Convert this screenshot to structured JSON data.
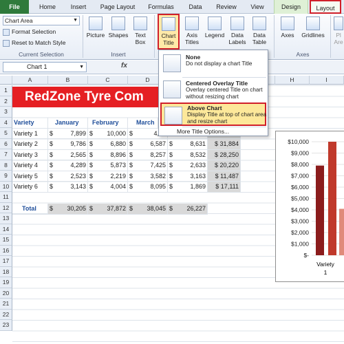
{
  "tabs": [
    {
      "label": "File"
    },
    {
      "label": "Home"
    },
    {
      "label": "Insert"
    },
    {
      "label": "Page Layout"
    },
    {
      "label": "Formulas"
    },
    {
      "label": "Data"
    },
    {
      "label": "Review"
    },
    {
      "label": "View"
    },
    {
      "label": "Design"
    },
    {
      "label": "Layout"
    }
  ],
  "ribbon": {
    "chart_element_dropdown": "Chart Area",
    "format_selection": "Format Selection",
    "reset_to_match_style": "Reset to Match Style",
    "current_selection_group": "Current Selection",
    "picture": "Picture",
    "shapes": "Shapes",
    "text_box_1": "Text",
    "text_box_2": "Box",
    "insert_group": "Insert",
    "chart_title_1": "Chart",
    "chart_title_2": "Title",
    "axis_titles_1": "Axis",
    "axis_titles_2": "Titles",
    "legend": "Legend",
    "data_labels_1": "Data",
    "data_labels_2": "Labels",
    "data_table_1": "Data",
    "data_table_2": "Table",
    "axes": "Axes",
    "gridlines": "Gridlines",
    "plot_area_1": "Pl",
    "plot_area_2": "Are",
    "axes_group": "Axes"
  },
  "formula_bar": {
    "name_box": "Chart 1",
    "fx": "fx"
  },
  "menu": {
    "items": [
      {
        "title": "None",
        "desc": "Do not display a chart Title"
      },
      {
        "title": "Centered Overlay Title",
        "desc": "Overlay centered Title on chart without resizing chart"
      },
      {
        "title": "Above Chart",
        "desc": "Display Title at top of chart area and resize chart"
      }
    ],
    "more": "More Title Options..."
  },
  "columns": [
    "A",
    "B",
    "C",
    "D",
    "E",
    "F",
    "G",
    "H",
    "I"
  ],
  "rows": [
    "1",
    "2",
    "3",
    "4",
    "5",
    "6",
    "7",
    "8",
    "9",
    "10",
    "11",
    "12",
    "13",
    "14",
    "15",
    "16",
    "17",
    "18",
    "19",
    "20",
    "21",
    "22",
    "23"
  ],
  "sheet": {
    "title": "RedZone Tyre Com",
    "headers": [
      "Variety",
      "January",
      "February",
      "March"
    ],
    "varieties": [
      {
        "name": "Variety 1",
        "jan": "7,899",
        "feb": "10,000",
        "mar": "4,09",
        "e": "",
        "total": ""
      },
      {
        "name": "Variety 2",
        "jan": "9,786",
        "feb": "6,880",
        "mar": "6,587",
        "e": "8,631",
        "total": "$ 31,884"
      },
      {
        "name": "Variety 3",
        "jan": "2,565",
        "feb": "8,896",
        "mar": "8,257",
        "e": "8,532",
        "total": "$ 28,250"
      },
      {
        "name": "Variety 4",
        "jan": "4,289",
        "feb": "5,873",
        "mar": "7,425",
        "e": "2,633",
        "total": "$ 20,220"
      },
      {
        "name": "Variety 5",
        "jan": "2,523",
        "feb": "2,219",
        "mar": "3,582",
        "e": "3,163",
        "total": "$ 11,487"
      },
      {
        "name": "Variety 6",
        "jan": "3,143",
        "feb": "4,004",
        "mar": "8,095",
        "e": "1,869",
        "total": "$ 17,111"
      }
    ],
    "total_label": "Total",
    "totals": [
      "30,205",
      "37,872",
      "38,045",
      "26,227"
    ],
    "currency": "$"
  },
  "chart_data": {
    "type": "bar",
    "yticks": [
      "$10,000",
      "$9,000",
      "$8,000",
      "$7,000",
      "$6,000",
      "$5,000",
      "$4,000",
      "$3,000",
      "$2,000",
      "$1,000",
      "$-"
    ],
    "ylim": [
      0,
      10000
    ],
    "categories": [
      "Variety 1"
    ],
    "category_label_1": "Variety",
    "category_label_2": "1",
    "series": [
      {
        "values": [
          7899
        ]
      },
      {
        "values": [
          10000
        ]
      },
      {
        "values": [
          4090
        ]
      }
    ],
    "colors": [
      "#8b1c1c",
      "#c0392b",
      "#e08a7a"
    ]
  }
}
